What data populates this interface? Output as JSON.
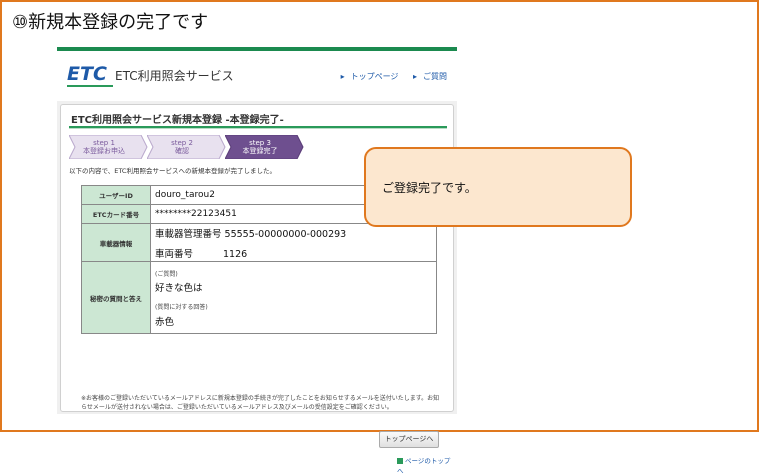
{
  "heading": "⑩新規本登録の完了です",
  "header": {
    "logo": "ETC",
    "site_name": "ETC利用照会サービス",
    "links": [
      "トップページ",
      "ご質問"
    ]
  },
  "panel": {
    "title": "ETC利用照会サービス新規本登録 -本登録完了-",
    "steps": [
      {
        "line1": "step 1",
        "line2": "本登録お申込"
      },
      {
        "line1": "step 2",
        "line2": "確認"
      },
      {
        "line1": "step 3",
        "line2": "本登録完了"
      }
    ],
    "intro": "以下の内容で、ETC利用照会サービスへの新規本登録が完了しました。"
  },
  "info": {
    "user_id_label": "ユーザーID",
    "user_id_value": "douro_tarou2",
    "card_label": "ETCカード番号",
    "card_value": "********22123451",
    "device_label": "車載器情報",
    "device_line1": "車載器管理番号 55555-00000000-000293",
    "device_line2_label": "車両番号",
    "device_line2_value": "1126",
    "secret_label": "秘密の質問と答え",
    "question_caption": "(ご質問)",
    "question_value": "好きな色は",
    "answer_caption": "(質問に対する回答)",
    "answer_value": "赤色"
  },
  "note": "※お客様のご登録いただいているメールアドレスに新規本登録の手続きが完了したことをお知らせするメールを送付いたします。お知らせメールが送付されない場合は、ご登録いただいているメールアドレス及びメールの受信設定をご確認ください。",
  "buttons": {
    "top_page": "トップページへ",
    "page_top": "ページのトップへ"
  },
  "callout": "ご登録完了です。"
}
